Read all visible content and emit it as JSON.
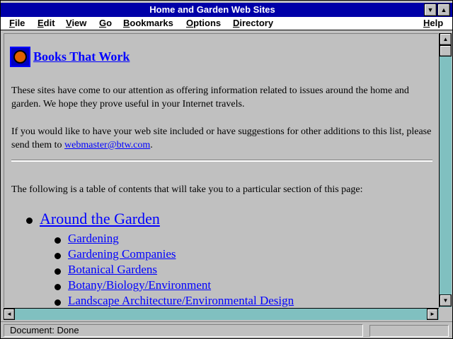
{
  "window": {
    "title": "Home and Garden Web Sites"
  },
  "titlebar": {
    "min_glyph": "▼",
    "max_glyph": "▲"
  },
  "menu": {
    "file": {
      "mn": "F",
      "rest": "ile"
    },
    "edit": {
      "mn": "E",
      "rest": "dit"
    },
    "view": {
      "mn": "V",
      "rest": "iew"
    },
    "go": {
      "mn": "G",
      "rest": "o"
    },
    "bookmarks": {
      "mn": "B",
      "rest": "ookmarks"
    },
    "options": {
      "mn": "O",
      "rest": "ptions"
    },
    "directory": {
      "mn": "D",
      "rest": "irectory"
    },
    "help": {
      "mn": "H",
      "rest": "elp"
    }
  },
  "page": {
    "heading": "Books That Work",
    "intro": "These sites have come to our attention as offering information related to issues around the home and garden. We hope they prove useful in your Internet travels.",
    "submit_text": "If you would like to have your web site included or have suggestions for other additions to this list, please send them to ",
    "submit_email": "webmaster@btw.com",
    "submit_end": ".",
    "toc_intro": "The following is a table of contents that will take you to a particular section of this page:",
    "toc": {
      "section": "Around the Garden",
      "items": [
        "Gardening",
        "Gardening Companies",
        "Botanical Gardens",
        "Botany/Biology/Environment",
        "Landscape Architecture/Environmental Design"
      ]
    }
  },
  "scrollbars": {
    "up": "▲",
    "down": "▼",
    "left": "◄",
    "right": "►"
  },
  "status": {
    "text": "Document: Done"
  },
  "colors": {
    "title_bar": "#0000a8",
    "link": "#0000ff",
    "background": "#c0c0c0",
    "scroll_track": "#80c0c0"
  }
}
